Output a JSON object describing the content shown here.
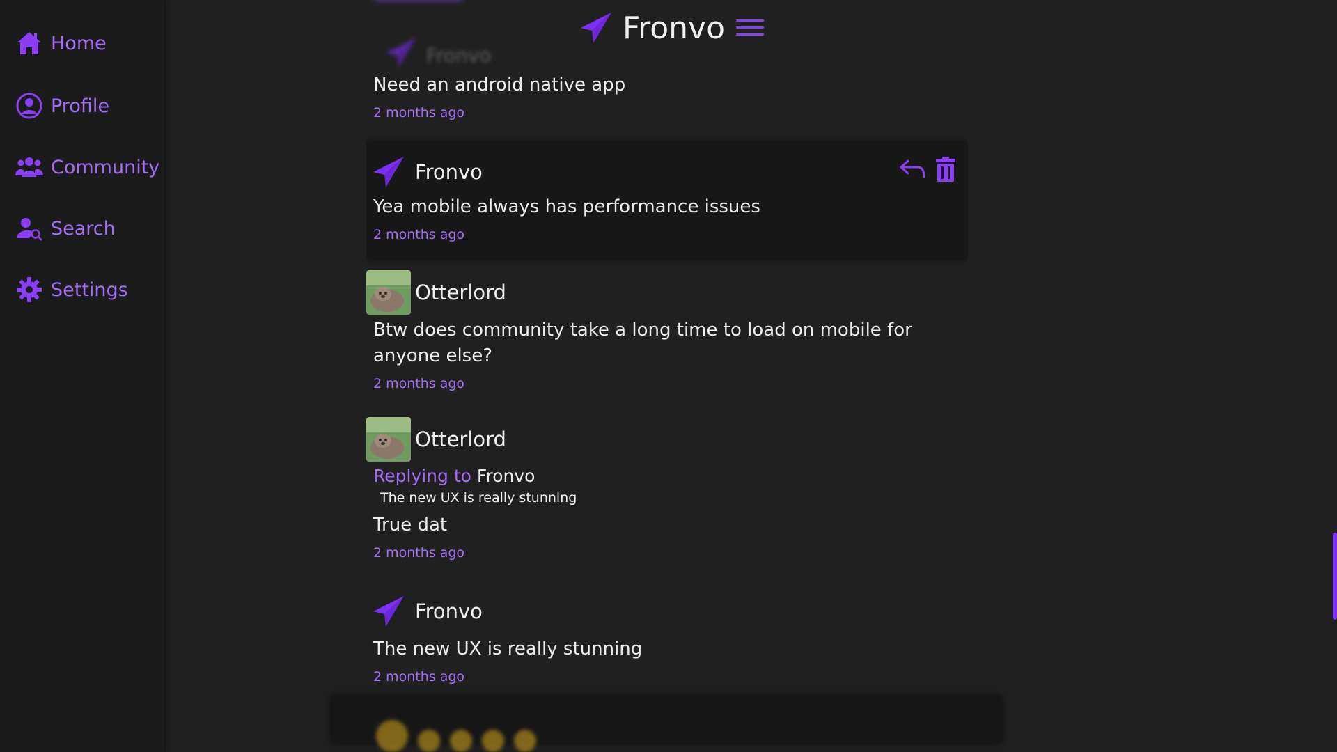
{
  "sidebar": {
    "items": [
      {
        "label": "Home",
        "icon": "home-icon"
      },
      {
        "label": "Profile",
        "icon": "user-circle-icon"
      },
      {
        "label": "Community",
        "icon": "users-icon"
      },
      {
        "label": "Search",
        "icon": "user-search-icon"
      },
      {
        "label": "Settings",
        "icon": "gear-icon"
      }
    ]
  },
  "header": {
    "title": "Fronvo",
    "logo": "paper-plane-icon",
    "menu_icon": "hamburger-menu-icon"
  },
  "feed": {
    "ghost_username": "Fronvo",
    "messages": [
      {
        "text": "Need an android native app",
        "time": "2 months ago"
      },
      {
        "username": "Fronvo",
        "text": "Yea mobile always has performance issues",
        "time": "2 months ago",
        "actions": [
          "reply-icon",
          "trash-icon"
        ]
      },
      {
        "username": "Otterlord",
        "text": "Btw does community take a long time to load on mobile for anyone else?",
        "time": "2 months ago"
      },
      {
        "username": "Otterlord",
        "reply_label": "Replying to",
        "reply_to": "Fronvo",
        "reply_quote": "The new UX is really stunning",
        "text": "True dat",
        "time": "2 months ago"
      },
      {
        "username": "Fronvo",
        "text": "The new UX is really stunning",
        "time": "2 months ago"
      }
    ]
  },
  "colors": {
    "accent": "#a46df5",
    "brand": "#7b2ff7",
    "background": "#202020",
    "sidebar": "#1b1b1b"
  }
}
